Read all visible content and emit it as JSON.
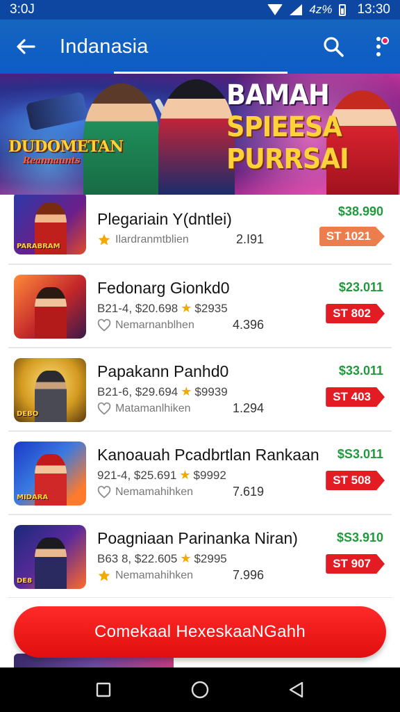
{
  "status_bar": {
    "left_text": "3:0J",
    "signal_text": "4z%",
    "time": "13:30"
  },
  "app_bar": {
    "title": "Indanasia",
    "icons": [
      "back-arrow-icon",
      "search-icon",
      "more-vert-icon"
    ]
  },
  "banner": {
    "logo_main": "DUDOMETAN",
    "logo_sub": "Reannaunts",
    "headline_1": "BAMAH",
    "headline_2": "SPIEESA",
    "headline_3": "PURRSAI"
  },
  "items": [
    {
      "title": "Plegariain Y(dntlei)",
      "meta_label": "Ilardranmtblien",
      "meta_icon": "star-icon",
      "count": "2.I91",
      "price": "$38.990",
      "tag": "ST 1021",
      "thumb_text": "PARABRAM"
    },
    {
      "title": "Fedonarg Gionkd0",
      "sub_prefix": "B21-4, $20.698",
      "sub_suffix": "$2935",
      "meta_label": "Nemarnanblhen",
      "meta_icon": "heart-icon",
      "count": "4.396",
      "price": "$23.011",
      "tag": "ST 802"
    },
    {
      "title": "Papakann Panhd0",
      "sub_prefix": "B21-6, $29.694",
      "sub_suffix": "$9939",
      "meta_label": "Matamanlhiken",
      "meta_icon": "heart-icon",
      "count": "1.294",
      "price": "$33.011",
      "tag": "ST 403",
      "thumb_text": "DEBO"
    },
    {
      "title": "Kanoauah Pcadbrtlan Rankaan",
      "sub_prefix": "921-4, $25.691",
      "sub_suffix": "$9992",
      "meta_label": "Nemamahihken",
      "meta_icon": "heart-icon",
      "count": "7.619",
      "price": "$S3.011",
      "tag": "ST 508",
      "thumb_text": "MIDARA"
    },
    {
      "title": "Poagniaan Parinanka Niran)",
      "sub_prefix": "B63 8, $22.605",
      "sub_suffix": "$2995",
      "meta_label": "Nemamahihken",
      "meta_icon": "star-icon",
      "count": "7.996",
      "price": "$S3.910",
      "tag": "ST 907",
      "thumb_text": "DE8"
    }
  ],
  "cta": {
    "label": "Comekaal HexeskaaNGahh"
  },
  "nav_bar": {
    "icons": [
      "recents-square-icon",
      "home-circle-icon",
      "back-triangle-icon"
    ]
  },
  "colors": {
    "app_bar": "#1565c0",
    "price_green": "#1e9a3a",
    "tag_red": "#e31b23",
    "tag_orange": "#ec7d4c",
    "cta_red": "#f01414",
    "star": "#f4a900"
  }
}
